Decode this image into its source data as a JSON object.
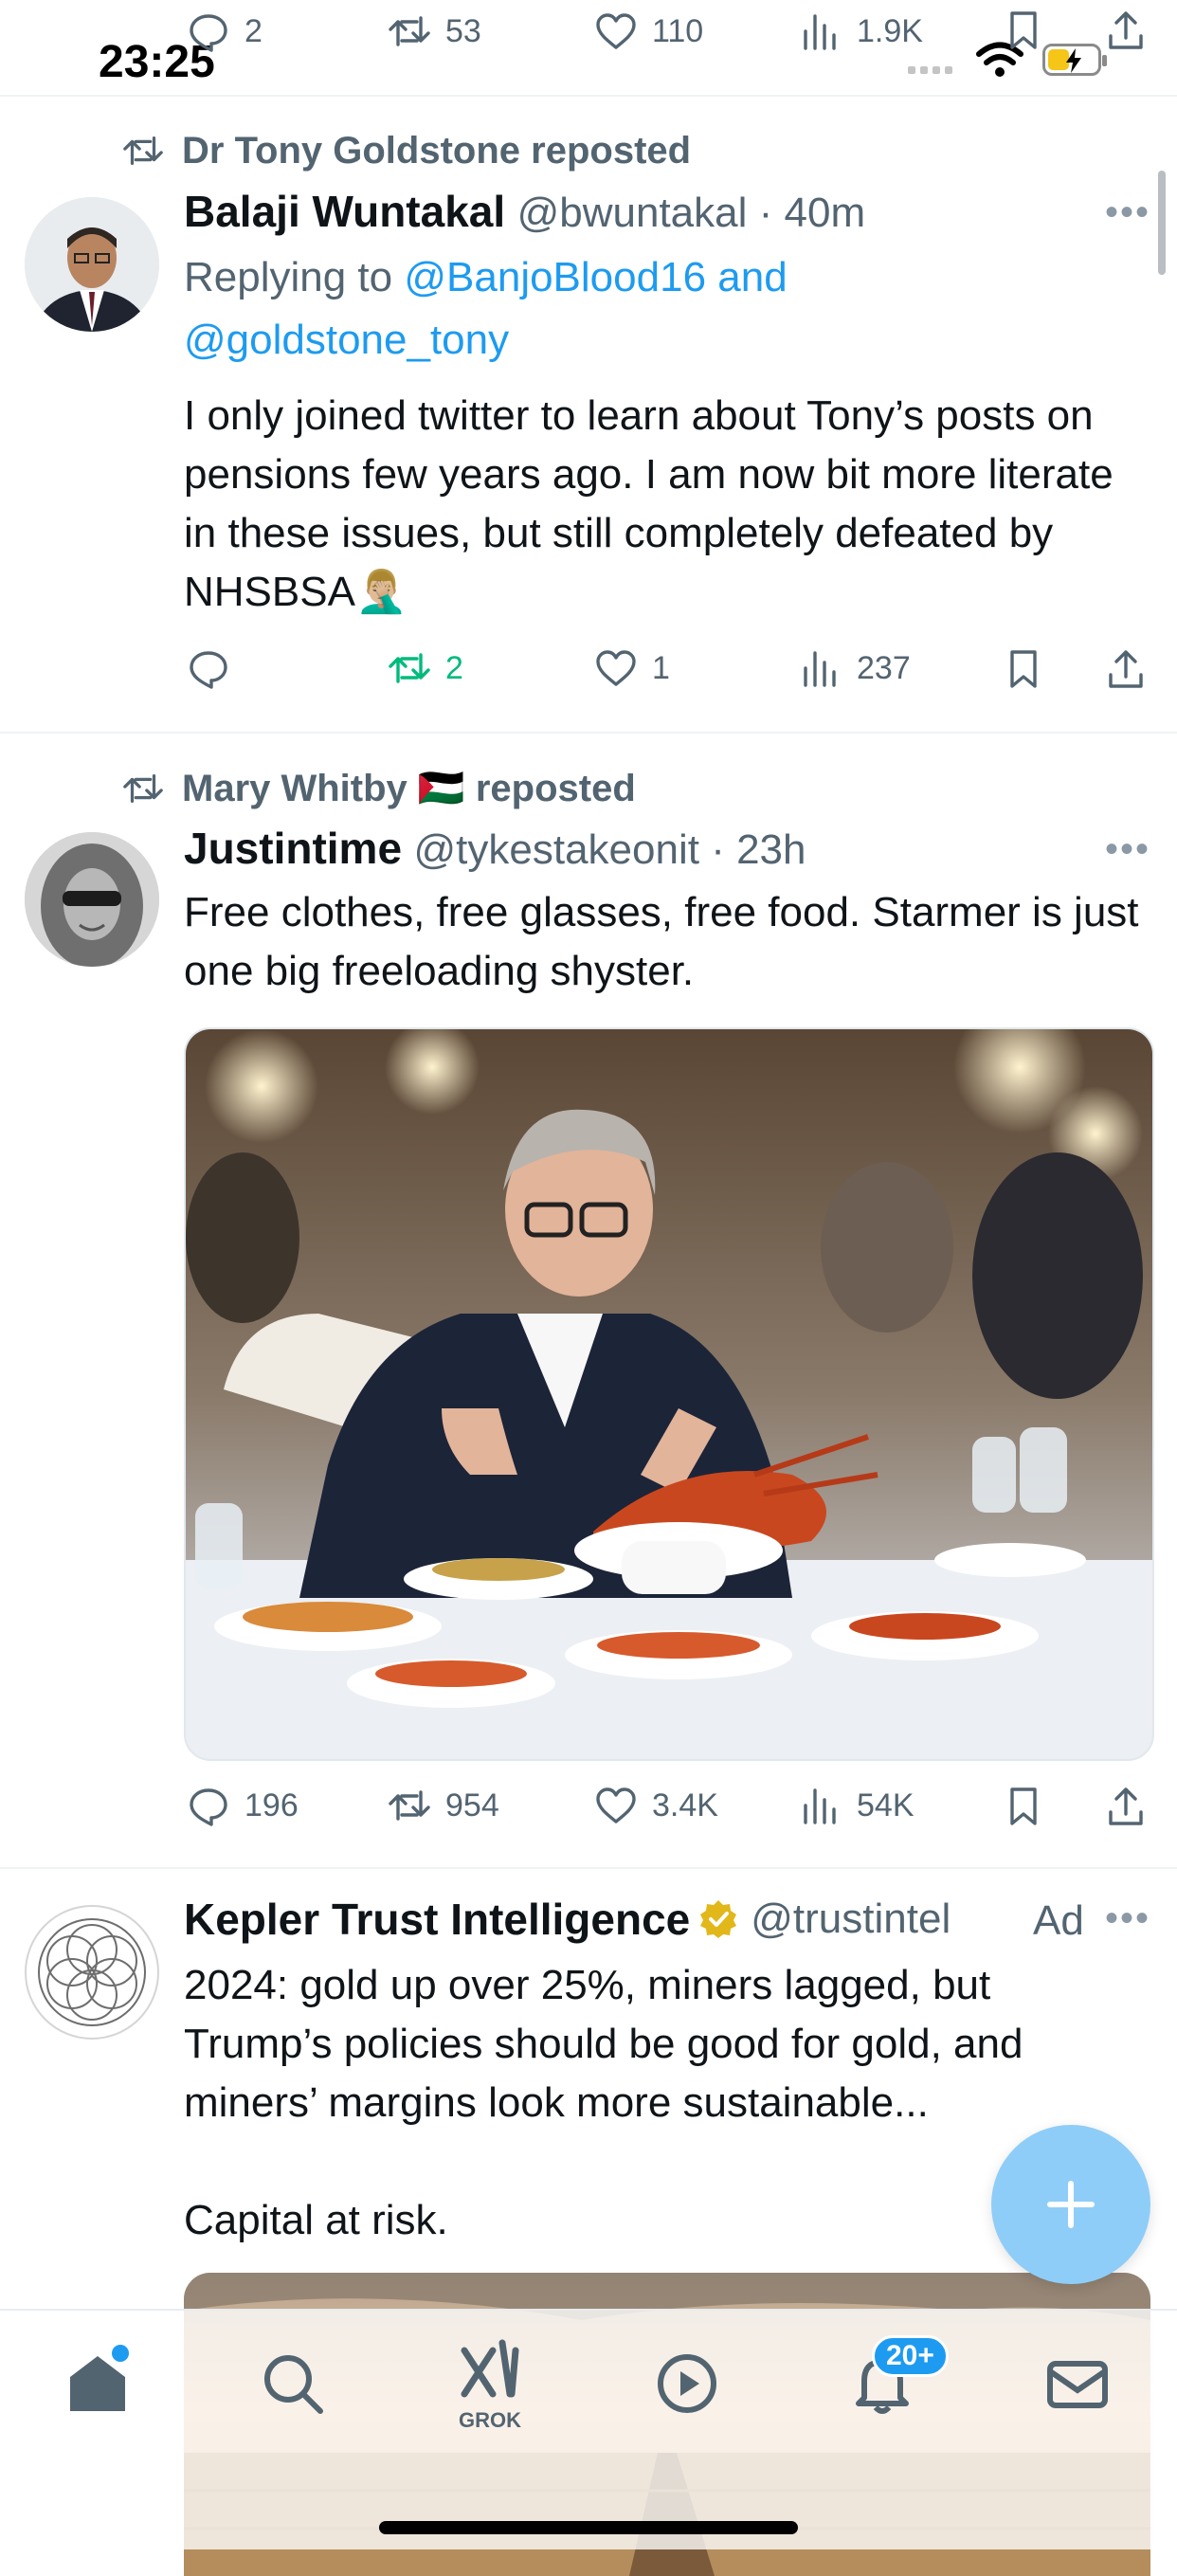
{
  "status_bar": {
    "time": "23:25"
  },
  "top_partial_metrics": {
    "replies": "2",
    "reposts": "53",
    "likes": "110",
    "views": "1.9K"
  },
  "tweets": [
    {
      "reposted_by": "Dr Tony Goldstone reposted",
      "name": "Balaji Wuntakal",
      "handle": "@bwuntakal",
      "time": "40m",
      "replying_to_prefix": "Replying to ",
      "replying_to_1": "@BanjoBlood16 and",
      "replying_to_2": "@goldstone_tony",
      "text": "I only joined twitter to learn about Tony’s posts on pensions few years ago. I am now bit more literate in these issues, but still completely defeated by NHSBSA🤦🏼‍♂️",
      "metrics": {
        "replies": "",
        "reposts": "2",
        "likes": "1",
        "views": "237"
      }
    },
    {
      "reposted_by": "Mary Whitby 🇵🇸 reposted",
      "name": "Justintime",
      "handle": "@tykestakeonit",
      "time": "23h",
      "text": "Free clothes, free glasses, free food. Starmer is just one big freeloading shyster.",
      "metrics": {
        "replies": "196",
        "reposts": "954",
        "likes": "3.4K",
        "views": "54K"
      }
    },
    {
      "name": "Kepler Trust Intelligence",
      "handle": "@trustintel",
      "ad_label": "Ad",
      "text_1": "2024: gold up over 25%, miners lagged, but Trump’s policies should be good for gold, and miners’ margins look more sustainable...",
      "text_2": "Capital at risk."
    }
  ],
  "tab_bar": {
    "grok_label": "GROK",
    "notifications_badge": "20+"
  },
  "colors": {
    "accent": "#1d9bf0",
    "repost_green": "#00ba7c",
    "muted": "#536471",
    "fab": "#8ecdf8"
  }
}
